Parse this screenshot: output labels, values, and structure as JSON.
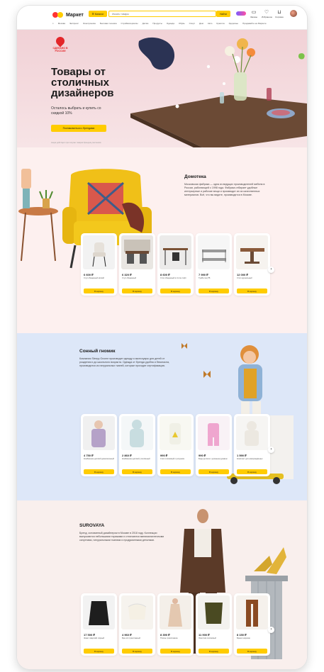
{
  "header": {
    "logo_text": "Маркет",
    "catalog_label": "Каталог",
    "search_placeholder": "Искать товары",
    "search_button": "Найти",
    "icons": [
      {
        "name": "orders",
        "label": "Заказы",
        "glyph": "▭"
      },
      {
        "name": "favorites",
        "label": "Избранное",
        "glyph": "♡"
      },
      {
        "name": "cart",
        "label": "Корзина",
        "glyph": "⊔"
      }
    ],
    "nav": [
      "Экспресс",
      "Электроника",
      "Бытовая техника",
      "Стройматериалы",
      "Детям",
      "Продукты",
      "Одежда",
      "Обувь",
      "Спорт",
      "Дом",
      "Авто",
      "Красота",
      "Здоровье",
      "Продавайте на Маркете"
    ],
    "city": "Москва"
  },
  "hero": {
    "badge": "Сделано в России",
    "title": "Товары от столичных дизайнеров",
    "subtitle": "Осталось выбрать и купить со скидкой 10%",
    "cta": "Познакомиться с брендами",
    "footnote": "Акция действует при покупке товаров брендов-участников"
  },
  "sections": [
    {
      "title": "Домотека",
      "text": "Московская фабрика — одна из ведущих производителей мебели в России, работающей с 1998 года. Фабрика отбирает удобные интерьерные и рабочие вещи и производит их из качественных материалов. Всё, что вы видите, производится в Москве.",
      "products": [
        {
          "price": "6 600 ₽",
          "name": "Стул обеденный мягкий",
          "buy": "В корзину"
        },
        {
          "price": "6 320 ₽",
          "name": "Стул обеденный",
          "buy": "В корзину"
        },
        {
          "price": "8 600 ₽",
          "name": "Стол обеденный в стиле лофт",
          "buy": "В корзину"
        },
        {
          "price": "7 990 ₽",
          "name": "Тумба под ТВ",
          "buy": "В корзину"
        },
        {
          "price": "12 000 ₽",
          "name": "Стол журнальный",
          "buy": "В корзину"
        }
      ]
    },
    {
      "title": "Сонный гномик",
      "text": "Компания Sleepy Gnome производит одежду и аксессуары для детей от рождения и до школьного возраста. Одежда от бренда удобна и безопасна, производится из натуральных тканей, которые проходят сертификацию.",
      "products": [
        {
          "price": "4 750 ₽",
          "name": "Комбинезон детский демисезонный",
          "buy": "В корзину"
        },
        {
          "price": "2 860 ₽",
          "name": "Комбинезон детский утеплённый",
          "buy": "В корзину"
        },
        {
          "price": "990 ₽",
          "name": "Слип хлопковый с рисунком",
          "buy": "В корзину"
        },
        {
          "price": "990 ₽",
          "name": "Боди детское с длинным рукавом",
          "buy": "В корзину"
        },
        {
          "price": "1 590 ₽",
          "name": "Комплект для новорождённых",
          "buy": "В корзину"
        }
      ]
    },
    {
      "title": "SUROVAYA",
      "text": "Бренд, основанный дизайнером в Москве в 2018 году. Коллекции выпускаются небольшими тиражами и отличаются минималистичными силуэтами, натуральными тканями и продуманными деталями.",
      "products": [
        {
          "price": "17 500 ₽",
          "name": "Жакет оверсайз чёрный",
          "buy": "В корзину"
        },
        {
          "price": "4 960 ₽",
          "name": "Бра-топ трикотажный",
          "buy": "В корзину"
        },
        {
          "price": "8 390 ₽",
          "name": "Платье трикотажное",
          "buy": "В корзину"
        },
        {
          "price": "11 900 ₽",
          "name": "Лонгслив хлопковый",
          "buy": "В корзину"
        },
        {
          "price": "8 150 ₽",
          "name": "Брюки широкие",
          "buy": "В корзину"
        }
      ]
    }
  ],
  "colors": {
    "accent": "#ffcc00",
    "brand_red": "#e32629",
    "section1_bg": "#fdf0ef",
    "section2_bg": "#dde7f8",
    "section3_bg": "#f9efed"
  }
}
